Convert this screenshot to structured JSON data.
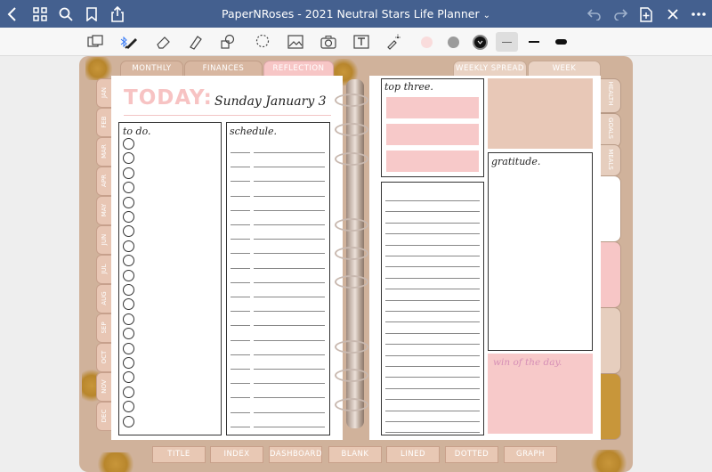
{
  "window": {
    "title": "PaperNRoses - 2021 Neutral Stars Life Planner",
    "title_chevron": "⌄"
  },
  "colors": {
    "topbar": "#44608f",
    "planner_tan": "#d0b29b",
    "pink": "#f7c9c9",
    "blush": "#e8c8b4",
    "gold": "#c8963a"
  },
  "top_tabs": [
    "MONTHLY PLAN",
    "FINANCES",
    "REFLECTION",
    "WEEKLY SPREAD",
    "WEEK REFLECTION"
  ],
  "bottom_tabs": [
    "TITLE",
    "INDEX",
    "DASHBOARD",
    "BLANK",
    "LINED",
    "DOTTED",
    "GRAPH"
  ],
  "months": [
    "JAN",
    "FEB",
    "MAR",
    "APR",
    "MAY",
    "JUN",
    "JUL",
    "AUG",
    "SEP",
    "OCT",
    "NOV",
    "DEC"
  ],
  "right_tabs": [
    "HEALTH",
    "GOALS",
    "MEALS"
  ],
  "left_page": {
    "today_label": "TODAY:",
    "date": "Sunday January 3",
    "todo_label": "to do.",
    "schedule_label": "schedule."
  },
  "right_page": {
    "top_three_label": "top three.",
    "gratitude_label": "gratitude.",
    "win_label": "win of the day."
  }
}
